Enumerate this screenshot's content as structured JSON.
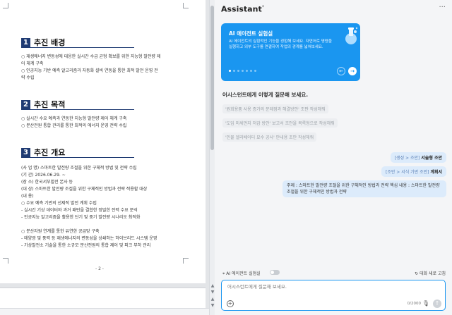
{
  "document": {
    "sections": [
      {
        "num": "1",
        "title": "추진 배경",
        "lines": [
          "○ 재생에너지 변동성에 대응한 실시간 수급 균형 확보를 위한 지능형 발전량 제",
          "어 체계 구축",
          "○ 인공지능 기반 예측 알고리즘과 자동화 설비 연동을 통한 최적 발전 운영 전",
          "략 수립"
        ]
      },
      {
        "num": "2",
        "title": "추진 목적",
        "lines": [
          "○ 실시간 수요 예측과 연동한 지능형 발전량 제어 체계 구축",
          "○ 분산전원 통합 관리를 통한 최적의 에너지 운영 전략 수립"
        ]
      },
      {
        "num": "3",
        "title": "추진 개요",
        "lines": [
          "(사 업 명) 스마트한 발전량 조절을 위한 구체적 방법 및 전략 수립",
          "(기        간) 2026.06.29. ~",
          "(장        소) 한국서부발전 본사 등",
          "(대        상) 스마트한 발전량 조절을 위한 구체적인 방법과 전략 적용할 대상",
          "(내        용)",
          "○ 수요 예측 기반의 선제적 발전 계획 수립",
          "- 실시간 기상 데이터와 과거 패턴을 결합한 정밀한 전력 수요 분석",
          "- 인공지능 알고리즘을 활용한 단기 및 중기 발전량 시나리오 최적화",
          "",
          "○ 분산자원 연계를 통한 유연한 공급망 구축",
          "- 태양광 및 풍력 등 재생에너지의 변동성을 상쇄하는 하이브리드 시스템 운영",
          "- 가상발전소 기술을 통한 소규모 분산전원의 통합 제어 및 피크 부하 관리"
        ]
      }
    ],
    "page_number": "- 2 -"
  },
  "assistant": {
    "title": "Assistant",
    "title_sup": "*",
    "more_label": "···",
    "card": {
      "title": "AI 에이전트 실험실",
      "description": "AI 에이전트의 실험적인 기능을 경험해 보세요. 자연어로 명령을 실행하고 외부 도구를 연결하여 작업의 경계를 넓혀보세요.",
      "dots": 7,
      "active_dot": 0,
      "prev_icon": "←",
      "next_icon": "→"
    },
    "suggest_title": "어시스턴트에게 이렇게 질문해 보세요.",
    "suggestions": [
      "'원회용품 사용 증가의 문제점과 해결방안' 조판 작성해줘",
      "'도입 미세먼지 저감 방안' 보고서 조안을 목록형으로 작성해줘",
      "'인물 엘리베이터 묘수 공사' 안내용 조안 작성해줘"
    ],
    "messages": [
      {
        "muted": "[생성 > 조안]",
        "bold": "서술형 조안"
      },
      {
        "muted": "[조안 > 서식 기반 조안]",
        "bold": "계획서"
      },
      {
        "text": "주제 : 스마트한 발전량 조절을 위한 구체적인 방법과 전략 핵심 내용 : 스마트한 발전량 조절을 위한 구체적인 방법과 전략"
      }
    ],
    "ai_toggle_label": "AI 에이전트 실험실",
    "new_chat_label": "대화 새로 고침",
    "input_placeholder": "어시스턴트에게 질문해 보세요.",
    "char_count": "0/2000",
    "colors": {
      "accent": "#1a96f0",
      "section_badge": "#1f3b73",
      "bubble": "#dcebfb"
    }
  }
}
